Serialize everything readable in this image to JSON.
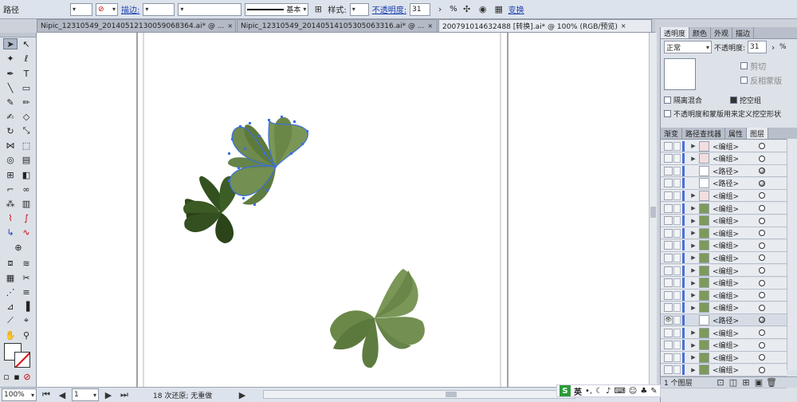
{
  "control_bar": {
    "object_type": "路径",
    "stroke_label": "描边:",
    "stroke_profile": "基本",
    "style_label": "样式:",
    "opacity_label": "不透明度:",
    "opacity_value": "31",
    "opacity_unit": "%",
    "transform_link": "变换"
  },
  "doc_tabs": [
    {
      "title": "Nipic_12310549_20140512130059068364.ai* @ ...",
      "close": "×"
    },
    {
      "title": "Nipic_12310549_20140514105305063316.ai* @ ...",
      "close": "×"
    },
    {
      "title": "20079101463248​8 [转换].ai* @ 100% (RGB/预览)",
      "close": "×"
    }
  ],
  "transparency_panel": {
    "tabs": [
      "透明度",
      "颜色",
      "外观",
      "描边"
    ],
    "blend_mode": "正常",
    "opacity_label": "不透明度:",
    "opacity_value": "31",
    "opacity_unit": "%",
    "clip_label": "剪切",
    "invert_mask_label": "反相蒙版",
    "isolate_blending_label": "隔离混合",
    "knockout_group_label": "挖空组",
    "opacity_mask_label": "不透明度和蒙版用来定义挖空形状"
  },
  "layers_panel": {
    "tabs": [
      "渐变",
      "路径查找器",
      "属性",
      "图层"
    ],
    "rows": [
      {
        "name": "<编组>",
        "type": "group"
      },
      {
        "name": "<编组>",
        "type": "group"
      },
      {
        "name": "<路径>",
        "type": "path"
      },
      {
        "name": "<路径>",
        "type": "path"
      },
      {
        "name": "<编组>",
        "type": "group"
      },
      {
        "name": "<编组>",
        "type": "group"
      },
      {
        "name": "<编组>",
        "type": "group"
      },
      {
        "name": "<编组>",
        "type": "group"
      },
      {
        "name": "<编组>",
        "type": "group"
      },
      {
        "name": "<编组>",
        "type": "group"
      },
      {
        "name": "<编组>",
        "type": "group"
      },
      {
        "name": "<编组>",
        "type": "group"
      },
      {
        "name": "<编组>",
        "type": "group"
      },
      {
        "name": "<编组>",
        "type": "group"
      },
      {
        "name": "<路径>",
        "type": "path"
      },
      {
        "name": "<编组>",
        "type": "group"
      },
      {
        "name": "<编组>",
        "type": "group"
      },
      {
        "name": "<编组>",
        "type": "group"
      },
      {
        "name": "<编组>",
        "type": "group"
      },
      {
        "name": "<编组>",
        "type": "group"
      }
    ],
    "footer": "1 个图层"
  },
  "status_bar": {
    "zoom": "100%",
    "page": "1",
    "history": "18 次还原; 无重做"
  },
  "ime": {
    "lang": "英"
  },
  "colors": {
    "leaf_dark": "#2f4a1c",
    "leaf_light": "#6e8a4c",
    "selection": "#3b6fe0"
  }
}
